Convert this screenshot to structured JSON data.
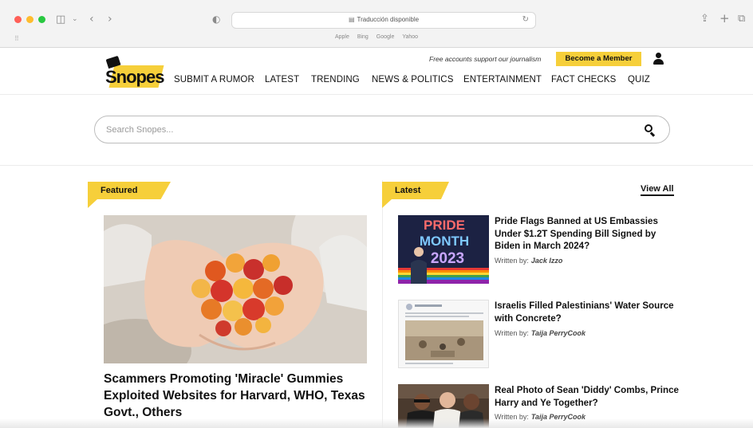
{
  "browser": {
    "address_text": "Traducción disponible",
    "favorites": [
      "Apple",
      "Bing",
      "Google",
      "Yahoo"
    ]
  },
  "site": {
    "logo_text": "Snopes",
    "tagline": "Free accounts support our journalism",
    "member_button": "Become a Member",
    "nav": [
      "SUBMIT A RUMOR",
      "LATEST",
      "TRENDING",
      "NEWS & POLITICS",
      "ENTERTAINMENT",
      "FACT CHECKS",
      "QUIZ"
    ],
    "search_placeholder": "Search Snopes..."
  },
  "featured": {
    "section_label": "Featured",
    "title": "Scammers Promoting 'Miracle' Gummies Exploited Websites for Harvard, WHO, Texas Govt., Others"
  },
  "latest": {
    "section_label": "Latest",
    "view_all": "View All",
    "items": [
      {
        "title": "Pride Flags Banned at US Embassies Under $1.2T Spending Bill Signed by Biden in March 2024?",
        "written_by_label": "Written by:",
        "author": "Jack Izzo",
        "thumb_text": [
          "PRIDE",
          "MONTH",
          "2023"
        ]
      },
      {
        "title": "Israelis Filled Palestinians' Water Source with Concrete?",
        "written_by_label": "Written by:",
        "author": "Taija PerryCook"
      },
      {
        "title": "Real Photo of Sean 'Diddy' Combs, Prince Harry and Ye Together?",
        "written_by_label": "Written by:",
        "author": "Taija PerryCook"
      }
    ]
  },
  "colors": {
    "accent_yellow": "#f6cf3a",
    "text": "#111111"
  }
}
